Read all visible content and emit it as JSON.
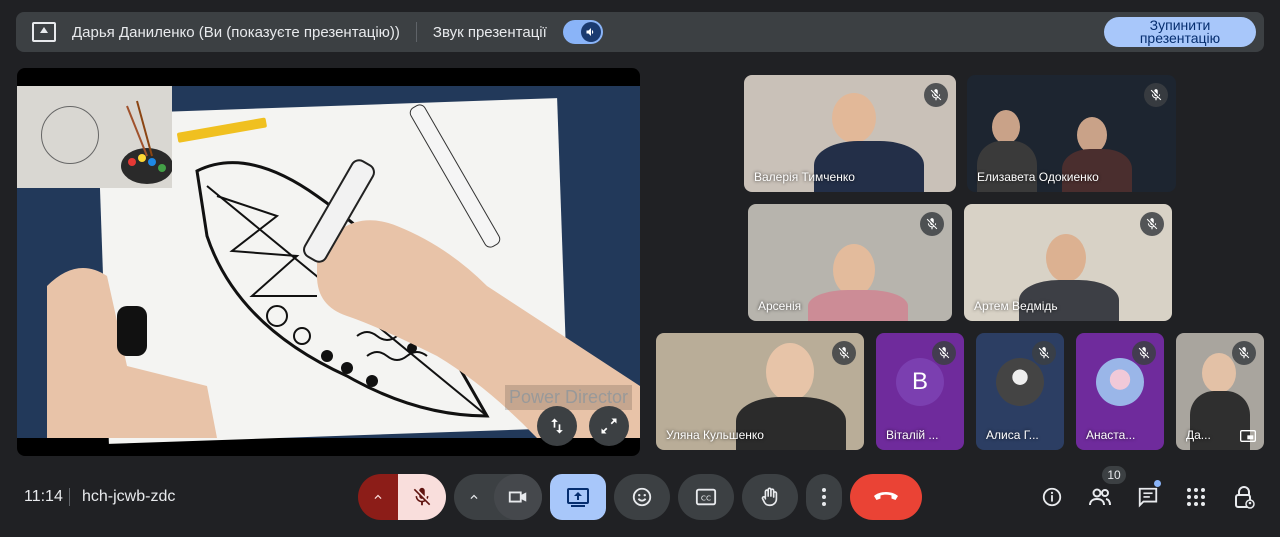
{
  "topbar": {
    "presenter": "Дарья Даниленко (Ви (показуєте презентацію))",
    "audio_label": "Звук презентації",
    "stop_button": "Зупинити презентацію"
  },
  "presentation": {
    "watermark": "Power Director"
  },
  "participants": [
    {
      "name": "Валерія Тимченко",
      "muted": true
    },
    {
      "name": "Елизавета Одокиенко",
      "muted": true
    },
    {
      "name": "Арсенія",
      "muted": true
    },
    {
      "name": "Артем Ведмідь",
      "muted": true
    },
    {
      "name": "Уляна Кульшенко",
      "muted": true
    },
    {
      "name": "Віталій ...",
      "muted": true,
      "initial": "В"
    },
    {
      "name": "Алиса Г...",
      "muted": true
    },
    {
      "name": "Анаста...",
      "muted": true
    },
    {
      "name": "Да...",
      "muted": true
    }
  ],
  "bottombar": {
    "time": "11:14",
    "meeting_code": "hch-jcwb-zdc",
    "participants_count": "10"
  },
  "colors": {
    "end_call": "#ea4335",
    "present_active": "#a8c7fa",
    "mic_off_bg": "#f9dedc",
    "mic_off_group": "#8c1d18",
    "tile_purple": "#6f2b9c",
    "tile_navy": "#2c3e63"
  }
}
